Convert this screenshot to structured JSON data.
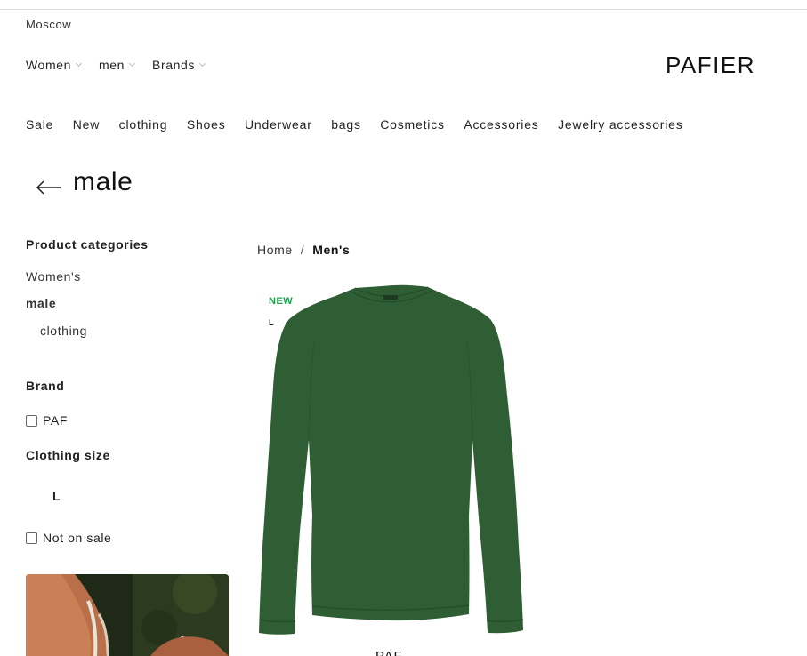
{
  "header": {
    "city": "Moscow",
    "gender_nav": [
      "Women",
      "men",
      "Brands"
    ],
    "logo": "PAFIER"
  },
  "category_nav": [
    "Sale",
    "New",
    "clothing",
    "Shoes",
    "Underwear",
    "bags",
    "Cosmetics",
    "Accessories",
    "Jewelry accessories"
  ],
  "page": {
    "title": "male"
  },
  "sidebar": {
    "categories_heading": "Product categories",
    "categories": {
      "women": "Women's",
      "male": "male",
      "clothing": "clothing"
    },
    "brand_heading": "Brand",
    "brand_option": "PAF",
    "size_heading": "Clothing size",
    "size_option": "L",
    "not_on_sale": "Not on sale"
  },
  "breadcrumb": {
    "home": "Home",
    "separator": "/",
    "current": "Men's"
  },
  "product": {
    "badge": "NEW",
    "size": "L",
    "brand": "PAF",
    "color": "#2f5e35"
  },
  "colors": {
    "badge_new": "#17a34a",
    "text": "#222222"
  }
}
